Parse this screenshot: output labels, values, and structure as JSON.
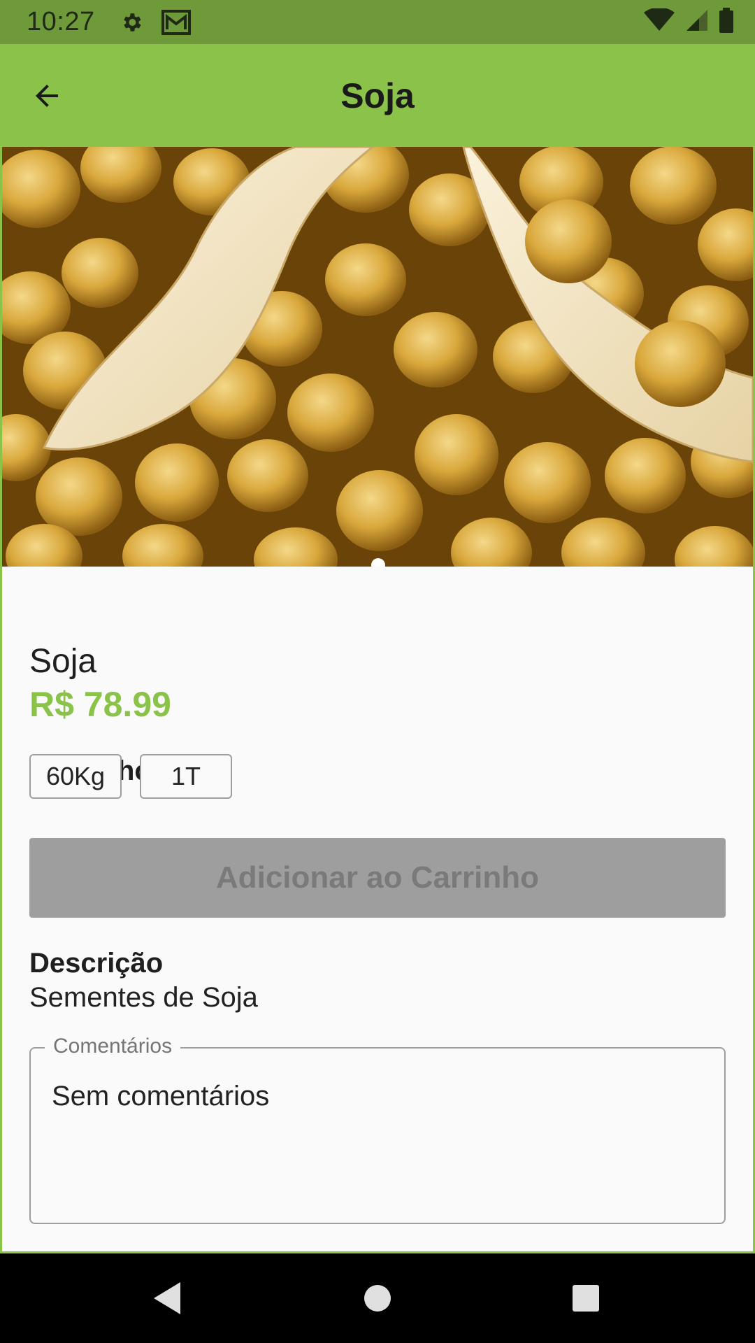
{
  "status_bar": {
    "time": "10:27",
    "icons": [
      "gear-icon",
      "mail-icon",
      "wifi-icon",
      "signal-icon",
      "battery-icon"
    ]
  },
  "app_bar": {
    "title": "Soja",
    "back_icon": "arrow-back-icon"
  },
  "product": {
    "name": "Soja",
    "price": "R$ 78.99",
    "image_description": "close-up of soybeans in open pods",
    "carousel_page": 1,
    "carousel_total": 1
  },
  "size": {
    "label": "Tamanho",
    "options": [
      "60Kg",
      "1T"
    ]
  },
  "cart_button": {
    "label": "Adicionar ao Carrinho",
    "enabled": false
  },
  "description": {
    "label": "Descrição",
    "text": "Sementes de Soja"
  },
  "comments": {
    "label": "Comentários",
    "value": "Sem comentários"
  },
  "nav_bar": {
    "icons": [
      "back-triangle-icon",
      "home-circle-icon",
      "recents-square-icon"
    ]
  },
  "colors": {
    "primary": "#8bc34a",
    "status_bar": "#6e9a3a",
    "button_disabled": "#9e9e9e",
    "background": "#fafafa"
  }
}
